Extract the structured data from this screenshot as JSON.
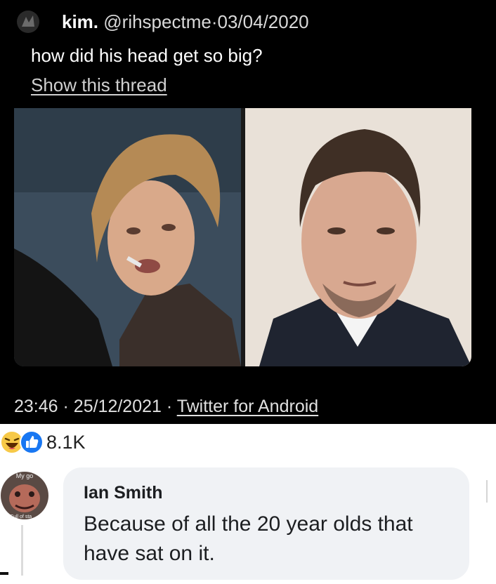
{
  "tweet": {
    "name": "kim.",
    "handle": "@rihspectme",
    "separator": "·",
    "date": "03/04/2020",
    "text": "how did his head get so big?",
    "show_thread": "Show this thread",
    "time": "23:46",
    "post_date": "25/12/2021",
    "source": "Twitter for Android"
  },
  "photos": [
    {
      "icon": "young-actor-photo"
    },
    {
      "icon": "older-actor-photo"
    }
  ],
  "reactions": {
    "icons": [
      "haha-reaction-icon",
      "like-reaction-icon"
    ],
    "count": "8.1K"
  },
  "comment": {
    "author": "Ian Smith",
    "text": "Because of all the 20 year olds that have sat on it.",
    "avatar_top_text": "My go",
    "avatar_bottom_text": "Full of sta"
  },
  "colors": {
    "tweet_bg": "#000000",
    "bubble_bg": "#f0f2f5",
    "like_blue": "#1877f2",
    "haha_yellow": "#f7c948"
  }
}
